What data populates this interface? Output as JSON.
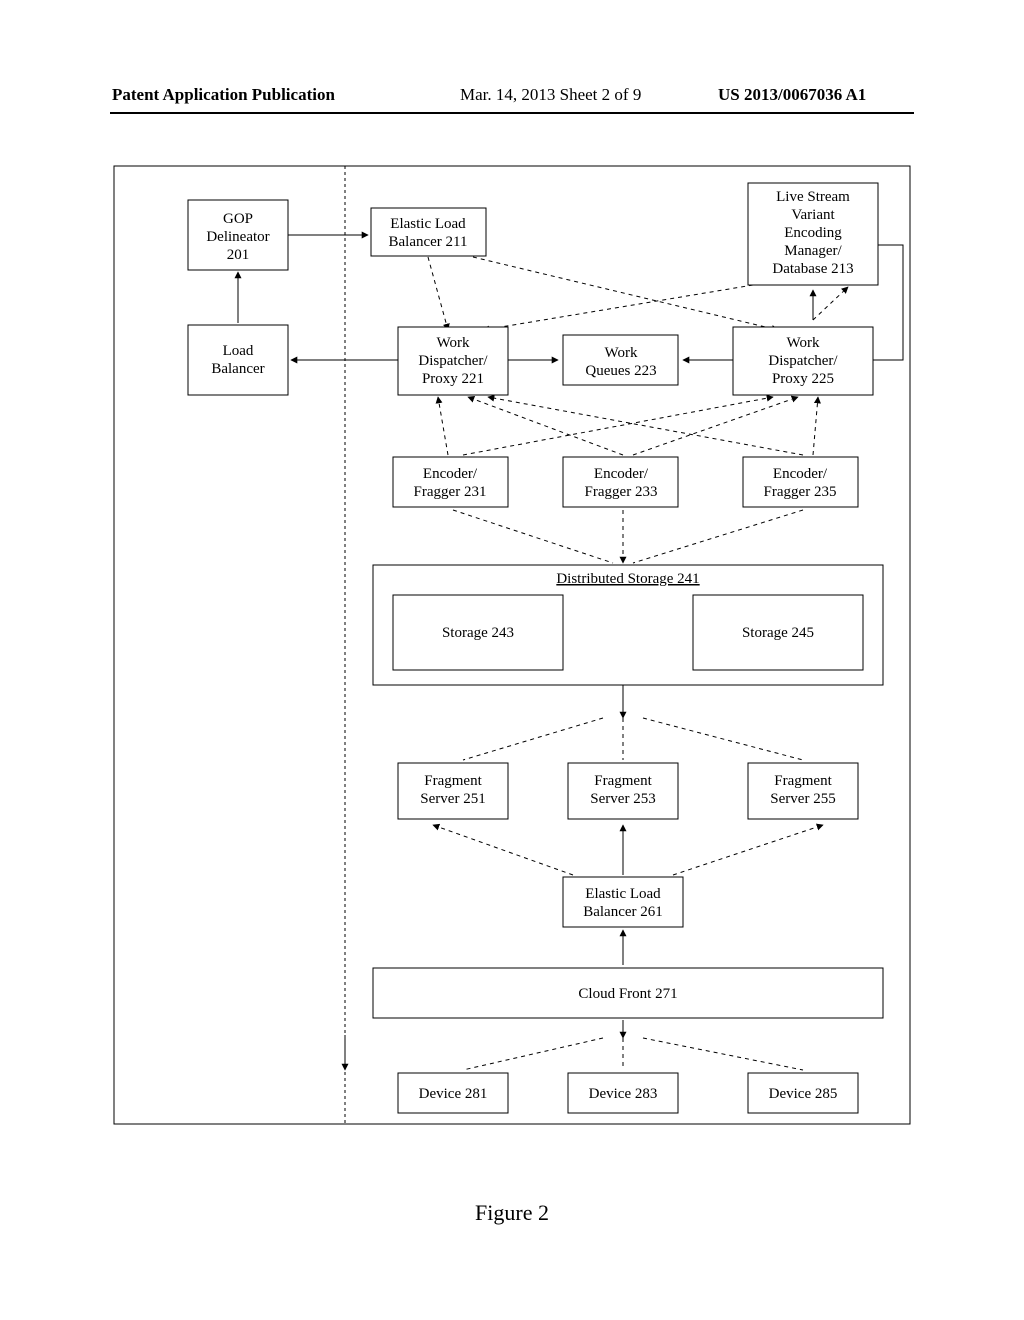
{
  "header": {
    "left": "Patent Application Publication",
    "mid": "Mar. 14, 2013  Sheet 2 of 9",
    "right": "US 2013/0067036 A1"
  },
  "figure_label": "Figure 2",
  "boxes": {
    "gop": {
      "l1": "GOP",
      "l2": "Delineator",
      "l3": "201"
    },
    "lb": {
      "l1": "Load",
      "l2": "Balancer"
    },
    "elb1": {
      "l1": "Elastic Load",
      "l2": "Balancer 211"
    },
    "mgr": {
      "l1": "Live Stream",
      "l2": "Variant",
      "l3": "Encoding",
      "l4": "Manager/",
      "l5": "Database 213"
    },
    "wd1": {
      "l1": "Work",
      "l2": "Dispatcher/",
      "l3": "Proxy 221"
    },
    "wq": {
      "l1": "Work",
      "l2": "Queues 223"
    },
    "wd2": {
      "l1": "Work",
      "l2": "Dispatcher/",
      "l3": "Proxy 225"
    },
    "ef1": {
      "l1": "Encoder/",
      "l2": "Fragger 231"
    },
    "ef2": {
      "l1": "Encoder/",
      "l2": "Fragger 233"
    },
    "ef3": {
      "l1": "Encoder/",
      "l2": "Fragger 235"
    },
    "ds": {
      "l1": "Distributed Storage 241"
    },
    "st1": {
      "l1": "Storage 243"
    },
    "st2": {
      "l1": "Storage 245"
    },
    "fs1": {
      "l1": "Fragment",
      "l2": "Server 251"
    },
    "fs2": {
      "l1": "Fragment",
      "l2": "Server 253"
    },
    "fs3": {
      "l1": "Fragment",
      "l2": "Server 255"
    },
    "elb2": {
      "l1": "Elastic Load",
      "l2": "Balancer 261"
    },
    "cf": {
      "l1": "Cloud Front 271"
    },
    "d1": {
      "l1": "Device 281"
    },
    "d2": {
      "l1": "Device 283"
    },
    "d3": {
      "l1": "Device 285"
    }
  },
  "chart_data": {
    "type": "diagram",
    "title": "Figure 2",
    "nodes": [
      {
        "id": "gop",
        "label": "GOP Delineator 201"
      },
      {
        "id": "lb",
        "label": "Load Balancer"
      },
      {
        "id": "elb1",
        "label": "Elastic Load Balancer 211"
      },
      {
        "id": "mgr",
        "label": "Live Stream Variant Encoding Manager/Database 213"
      },
      {
        "id": "wd1",
        "label": "Work Dispatcher/Proxy 221"
      },
      {
        "id": "wq",
        "label": "Work Queues 223"
      },
      {
        "id": "wd2",
        "label": "Work Dispatcher/Proxy 225"
      },
      {
        "id": "ef1",
        "label": "Encoder/Fragger 231"
      },
      {
        "id": "ef2",
        "label": "Encoder/Fragger 233"
      },
      {
        "id": "ef3",
        "label": "Encoder/Fragger 235"
      },
      {
        "id": "ds",
        "label": "Distributed Storage 241"
      },
      {
        "id": "st1",
        "label": "Storage 243"
      },
      {
        "id": "st2",
        "label": "Storage 245"
      },
      {
        "id": "fs1",
        "label": "Fragment Server 251"
      },
      {
        "id": "fs2",
        "label": "Fragment Server 253"
      },
      {
        "id": "fs3",
        "label": "Fragment Server 255"
      },
      {
        "id": "elb2",
        "label": "Elastic Load Balancer 261"
      },
      {
        "id": "cf",
        "label": "Cloud Front 271"
      },
      {
        "id": "d1",
        "label": "Device 281"
      },
      {
        "id": "d2",
        "label": "Device 283"
      },
      {
        "id": "d3",
        "label": "Device 285"
      }
    ],
    "edges": [
      {
        "from": "lb",
        "to": "gop",
        "style": "solid"
      },
      {
        "from": "gop",
        "to": "elb1",
        "style": "solid"
      },
      {
        "from": "wd1",
        "to": "lb",
        "style": "solid"
      },
      {
        "from": "elb1",
        "to": "wd1",
        "style": "dashed"
      },
      {
        "from": "elb1",
        "to": "wd2",
        "style": "dashed"
      },
      {
        "from": "mgr",
        "to": "wd1",
        "style": "dashed"
      },
      {
        "from": "wd2",
        "to": "mgr",
        "style": "solid"
      },
      {
        "from": "wd1",
        "to": "wq",
        "style": "solid"
      },
      {
        "from": "wd2",
        "to": "wq",
        "style": "solid"
      },
      {
        "from": "ef1",
        "to": "wd1",
        "style": "dashed"
      },
      {
        "from": "ef1",
        "to": "wd2",
        "style": "dashed"
      },
      {
        "from": "ef2",
        "to": "wd1",
        "style": "dashed"
      },
      {
        "from": "ef2",
        "to": "wd2",
        "style": "dashed"
      },
      {
        "from": "ef3",
        "to": "wd1",
        "style": "dashed"
      },
      {
        "from": "ef3",
        "to": "wd2",
        "style": "dashed"
      },
      {
        "from": "ef1",
        "to": "ds",
        "style": "dashed"
      },
      {
        "from": "ef2",
        "to": "ds",
        "style": "dashed"
      },
      {
        "from": "ef3",
        "to": "ds",
        "style": "dashed"
      },
      {
        "from": "ds",
        "to": "fs1",
        "style": "dashed"
      },
      {
        "from": "ds",
        "to": "fs2",
        "style": "dashed"
      },
      {
        "from": "ds",
        "to": "fs3",
        "style": "dashed"
      },
      {
        "from": "elb2",
        "to": "fs1",
        "style": "dashed"
      },
      {
        "from": "elb2",
        "to": "fs2",
        "style": "solid"
      },
      {
        "from": "elb2",
        "to": "fs3",
        "style": "dashed"
      },
      {
        "from": "cf",
        "to": "elb2",
        "style": "solid"
      },
      {
        "from": "cf",
        "to": "d1",
        "style": "dashed"
      },
      {
        "from": "cf",
        "to": "d2",
        "style": "dashed"
      },
      {
        "from": "cf",
        "to": "d3",
        "style": "dashed"
      },
      {
        "from": "lb",
        "to": "d1-region",
        "style": "dashed",
        "note": "boundary line to device tier"
      }
    ]
  }
}
